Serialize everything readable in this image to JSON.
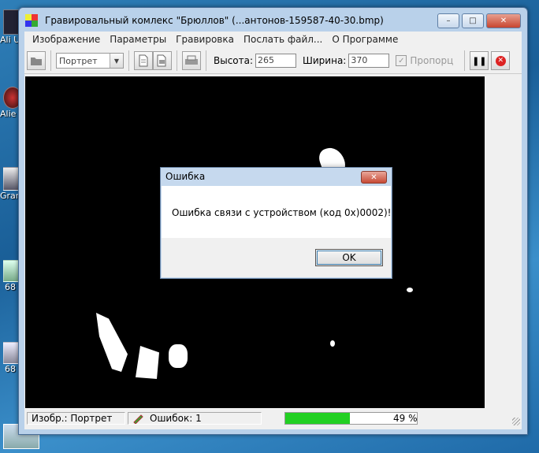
{
  "desktop": {
    "icons": [
      {
        "label": "Ali Unl"
      },
      {
        "label": "Alie Prec"
      },
      {
        "label": "Gran Auto"
      },
      {
        "label": "68"
      },
      {
        "label": "68"
      }
    ]
  },
  "window": {
    "title": "Гравировальный комлекс \"Брюллов\" (...антонов-159587-40-30.bmp)",
    "caption_buttons": {
      "minimize": "–",
      "maximize": "□",
      "close": "✕"
    }
  },
  "menu": {
    "items": [
      "Изображение",
      "Параметры",
      "Гравировка",
      "Послать файл...",
      "О Программе"
    ]
  },
  "toolbar": {
    "mode_value": "Портрет",
    "height_label": "Высота:",
    "height_value": "265",
    "width_label": "Ширина:",
    "width_value": "370",
    "proportional_label": "Пропорц",
    "proportional_checked": true,
    "icons": [
      "folder-icon",
      "document-icon",
      "document-settings-icon",
      "printer-icon",
      "pause-icon",
      "stop-icon"
    ]
  },
  "status": {
    "image_label": "Изобр.: Портрет",
    "errors_label": "Ошибок: 1",
    "progress_text": "49 %",
    "progress_fraction": 0.49
  },
  "dialog": {
    "title": "Ошибка",
    "message": "Ошибка связи с устройством (код 0x)0002)!",
    "ok_label": "OK",
    "close_label": "✕"
  },
  "colors": {
    "progress": "#22d022",
    "canvas": "#000000",
    "stop_button": "#d22222"
  }
}
